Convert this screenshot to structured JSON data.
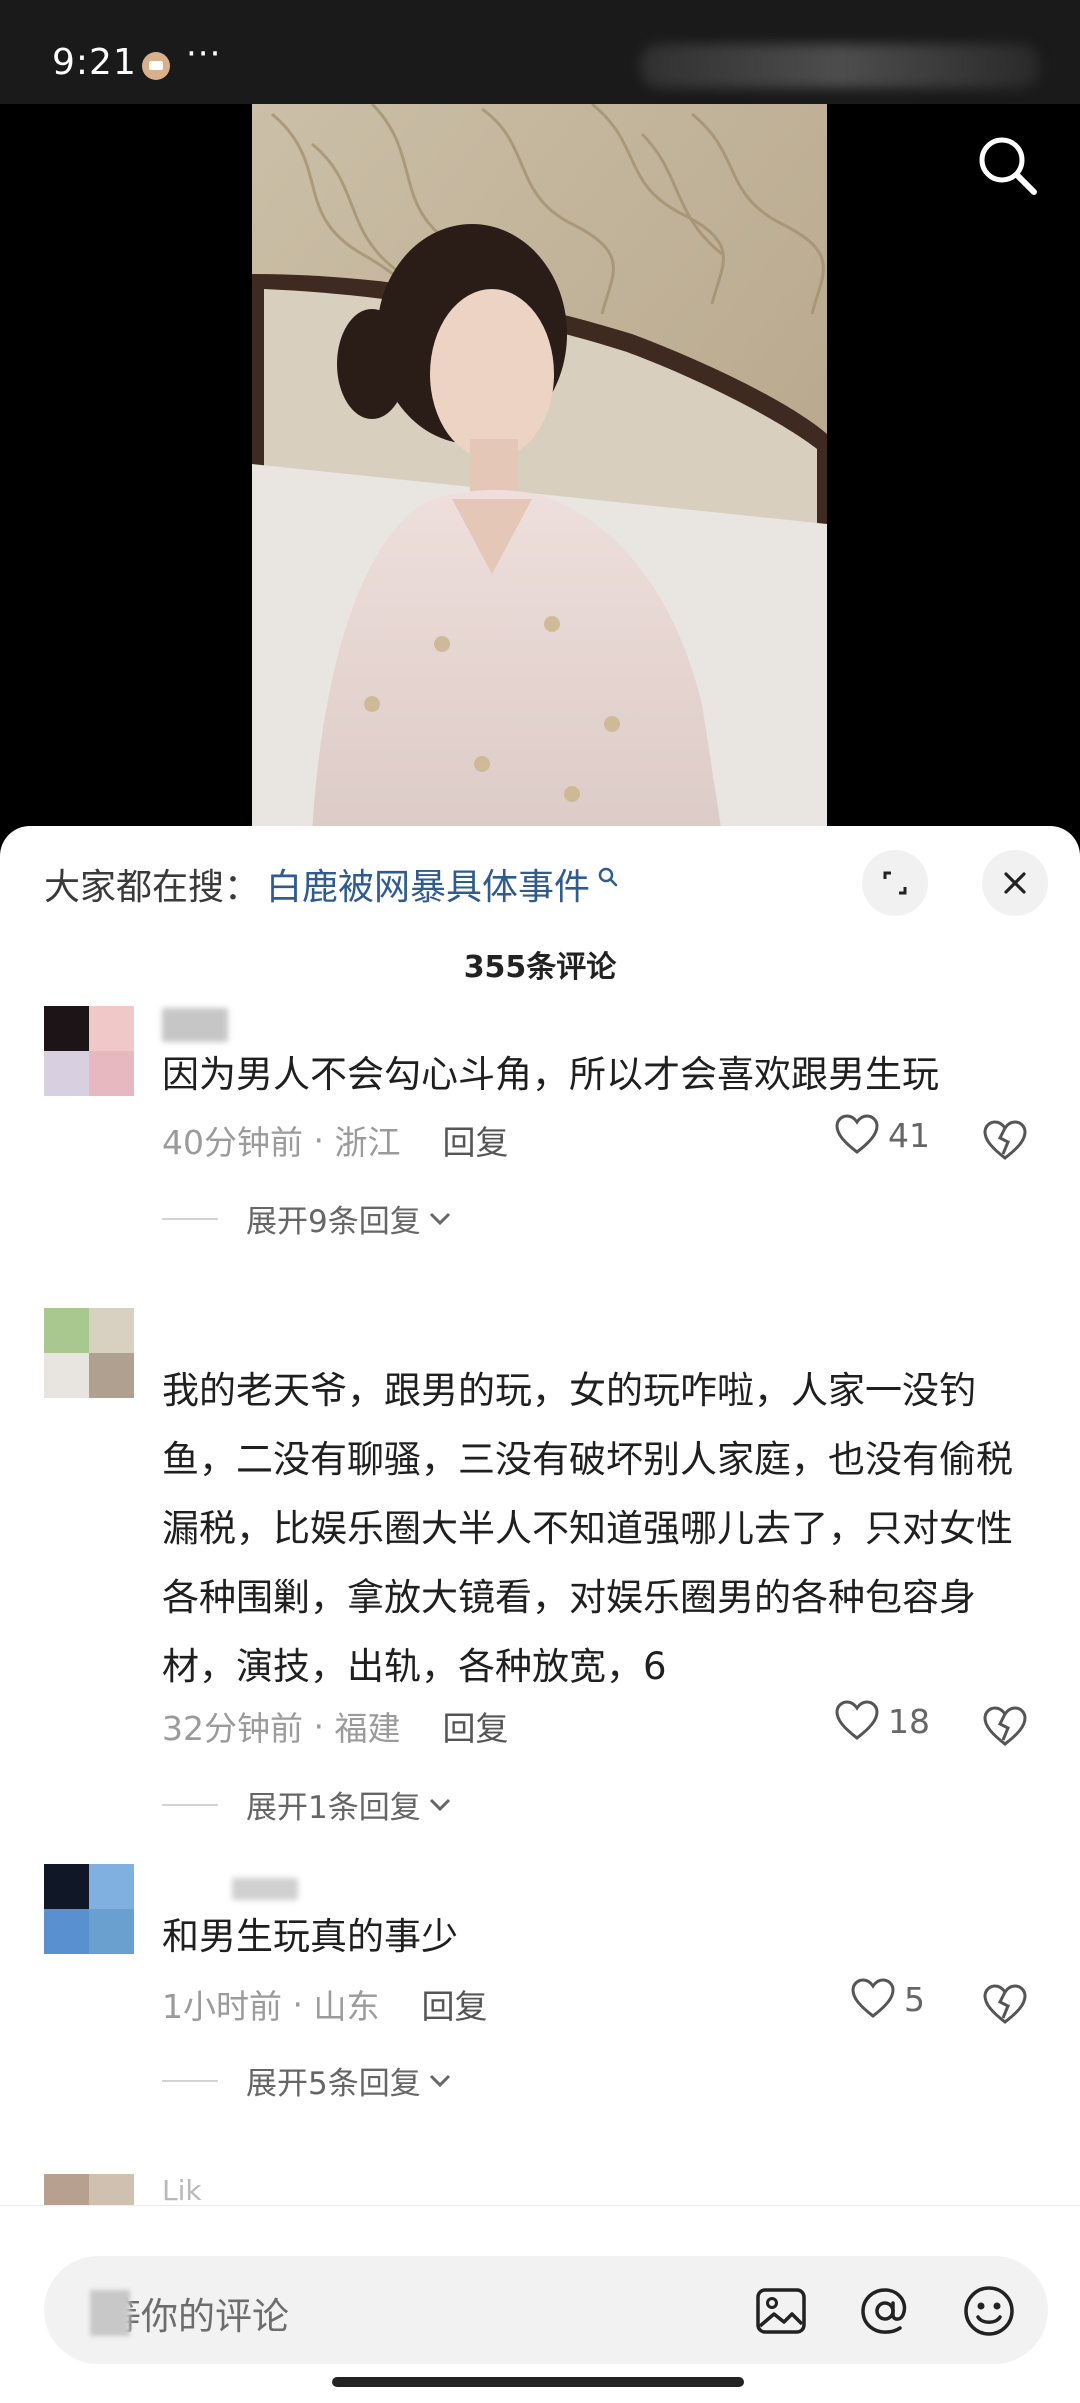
{
  "status_bar": {
    "time": "9:21",
    "more": "···"
  },
  "video": {
    "search_icon": "search-icon"
  },
  "sheet": {
    "trending_prefix": "大家都在搜：",
    "trending_query": "白鹿被网暴具体事件",
    "comment_count": "355条评论"
  },
  "comments": [
    {
      "username": "",
      "text": "因为男人不会勾心斗角，所以才会喜欢跟男生玩",
      "time": "40分钟前",
      "location": "浙江",
      "reply_label": "回复",
      "likes": "41",
      "expand_label": "展开9条回复",
      "avatar_colors": [
        "#1c1416",
        "#f0c8c8",
        "#d8d0e0",
        "#e8b8c0"
      ]
    },
    {
      "username": "",
      "text": "我的老天爷，跟男的玩，女的玩咋啦，人家一没钓鱼，二没有聊骚，三没有破坏别人家庭，也没有偷税漏税，比娱乐圈大半人不知道强哪儿去了，只对女性各种围剿，拿放大镜看，对娱乐圈男的各种包容身材，演技，出轨，各种放宽，6",
      "time": "32分钟前",
      "location": "福建",
      "reply_label": "回复",
      "likes": "18",
      "expand_label": "展开1条回复",
      "avatar_colors": [
        "#a8c890",
        "#d8d0c0",
        "#e8e4e0",
        "#b0a090"
      ]
    },
    {
      "username": "",
      "text": "和男生玩真的事少",
      "time": "1小时前",
      "location": "山东",
      "reply_label": "回复",
      "likes": "5",
      "expand_label": "展开5条回复",
      "avatar_colors": [
        "#101828",
        "#80b0e0",
        "#5890d0",
        "#6aa0d0"
      ]
    },
    {
      "username": "Lik",
      "avatar_colors": [
        "#b8a090",
        "#d0c0b0",
        "#c8b0a0",
        "#d8c8b8"
      ]
    }
  ],
  "input_bar": {
    "placeholder": "等你的评论",
    "icons": [
      "image-icon",
      "at-icon",
      "emoji-icon"
    ]
  },
  "colors": {
    "link": "#2f5b8e",
    "meta": "#9b9b9b",
    "text": "#1f1f1f"
  }
}
